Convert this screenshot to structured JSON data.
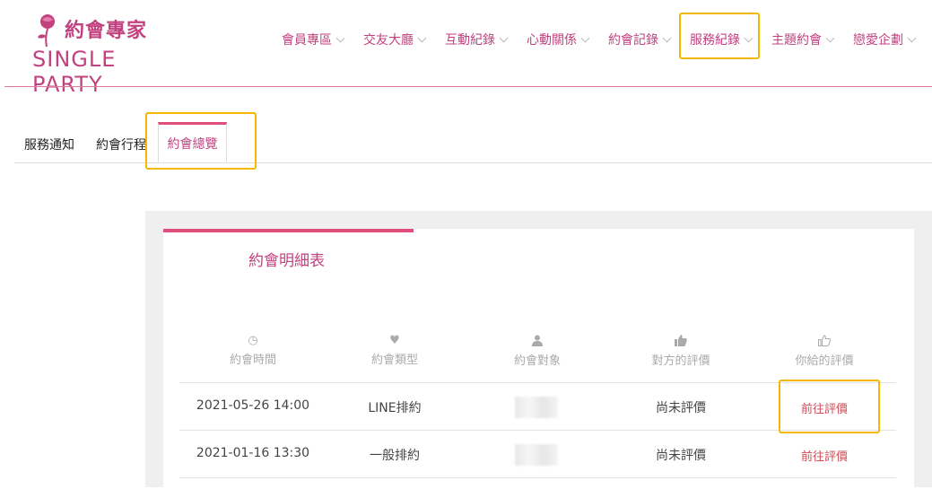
{
  "logo": {
    "cn": "約會專家",
    "en": "SINGLE PARTY",
    "icon": "rose-icon"
  },
  "nav": [
    {
      "label": "會員專區"
    },
    {
      "label": "交友大廳"
    },
    {
      "label": "互動紀錄"
    },
    {
      "label": "心動關係"
    },
    {
      "label": "約會記錄"
    },
    {
      "label": "服務紀錄"
    },
    {
      "label": "主題約會"
    },
    {
      "label": "戀愛企劃"
    }
  ],
  "tabs": [
    {
      "label": "服務通知"
    },
    {
      "label": "約會行程"
    },
    {
      "label": "約會總覽"
    }
  ],
  "card": {
    "title": "約會明細表",
    "columns": [
      {
        "label": "約會時間",
        "icon": "clock-icon"
      },
      {
        "label": "約會類型",
        "icon": "heart-icon"
      },
      {
        "label": "約會對象",
        "icon": "user-icon"
      },
      {
        "label": "對方的評價",
        "icon": "thumbs-up-filled-icon"
      },
      {
        "label": "你給的評價",
        "icon": "thumbs-up-outline-icon"
      }
    ],
    "rows": [
      {
        "time": "2021-05-26 14:00",
        "type": "LINE排約",
        "partner_rating": "尚未評價",
        "action": "前往評價"
      },
      {
        "time": "2021-01-16 13:30",
        "type": "一般排約",
        "partner_rating": "尚未評價",
        "action": "前往評價"
      }
    ]
  },
  "colors": {
    "brand": "#c2417f",
    "accent": "#e04f7c",
    "highlight": "#f5b800"
  }
}
